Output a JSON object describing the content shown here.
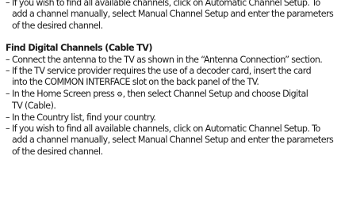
{
  "section_top": {
    "items": [
      {
        "lines": [
          "If you wish to find all available channels, click on Automatic Channel Setup. To",
          "add a channel manually, select Manual Channel Setup and enter the parameters",
          "of the desired channel."
        ]
      }
    ]
  },
  "section_cable": {
    "heading": "Find Digital Channels (Cable TV)",
    "items": [
      {
        "lines": [
          "Connect the antenna to the TV as shown in the “Antenna Connection” section."
        ]
      },
      {
        "lines": [
          "If the TV service provider requires the use of a decoder card, insert the card",
          "into the COMMON INTERFACE slot on the back panel of the TV."
        ]
      },
      {
        "line1_before_icon": "In the Home Screen press ",
        "line1_after_icon": ", then select Channel Setup and choose Digital",
        "line2": "TV (Cable).",
        "icon": "gear-icon"
      },
      {
        "lines": [
          "In the Country list, find your country."
        ]
      },
      {
        "lines": [
          "If you wish to find all available channels, click on Automatic Channel Setup. To",
          "add a channel manually, select Manual Channel Setup and enter the parameters",
          "of the desired channel."
        ]
      }
    ]
  },
  "bullet_symbol": "–"
}
